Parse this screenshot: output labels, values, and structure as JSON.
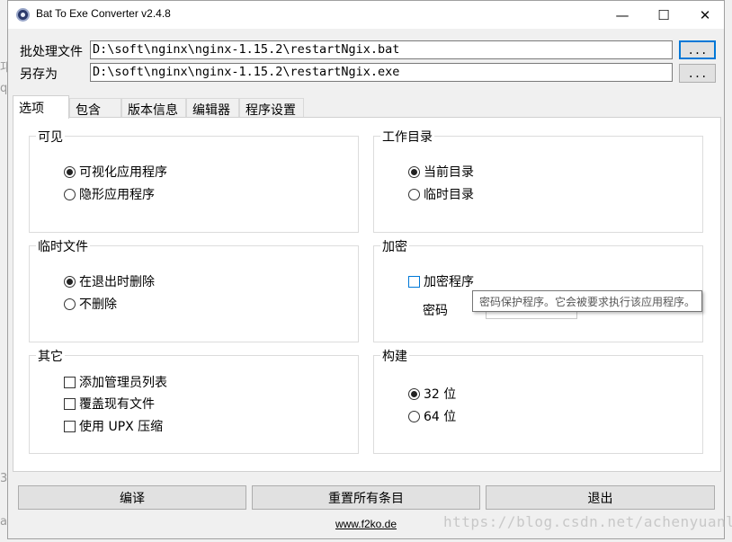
{
  "window": {
    "title": "Bat To Exe Converter v2.4.8",
    "controls": {
      "minimize": "—",
      "maximize": "☐",
      "close": "✕"
    }
  },
  "batch_file": {
    "label": "批处理文件",
    "value": "D:\\soft\\nginx\\nginx-1.15.2\\restartNgix.bat",
    "browse_label": "..."
  },
  "save_as": {
    "label": "另存为",
    "value": "D:\\soft\\nginx\\nginx-1.15.2\\restartNgix.exe",
    "browse_label": "..."
  },
  "tabs": [
    {
      "label": "选项",
      "active": true
    },
    {
      "label": "包含"
    },
    {
      "label": "版本信息"
    },
    {
      "label": "编辑器"
    },
    {
      "label": "程序设置"
    }
  ],
  "groups": {
    "visibility": {
      "title": "可见",
      "options": [
        "可视化应用程序",
        "隐形应用程序"
      ],
      "selected": 0
    },
    "working_dir": {
      "title": "工作目录",
      "options": [
        "当前目录",
        "临时目录"
      ],
      "selected": 0
    },
    "temp_files": {
      "title": "临时文件",
      "options": [
        "在退出时删除",
        "不删除"
      ],
      "selected": 0
    },
    "encrypt": {
      "title": "加密",
      "checkbox": "加密程序",
      "password_label": "密码",
      "tooltip": "密码保护程序。它会被要求执行该应用程序。"
    },
    "other": {
      "title": "其它",
      "options": [
        "添加管理员列表",
        "覆盖现有文件",
        "使用 UPX 压缩"
      ]
    },
    "build": {
      "title": "构建",
      "options": [
        "32 位",
        "64 位"
      ],
      "selected": 0
    }
  },
  "buttons": {
    "compile": "编译",
    "reset": "重置所有条目",
    "exit": "退出"
  },
  "footer": {
    "link": "www.f2ko.de"
  },
  "watermark": "https://blog.csdn.net/achenyuanl",
  "edge_fragments": [
    "邛",
    "q",
    "3",
    "a"
  ],
  "colors": {
    "focus_border": "#0078d7",
    "tooltip_text": "#575757"
  }
}
